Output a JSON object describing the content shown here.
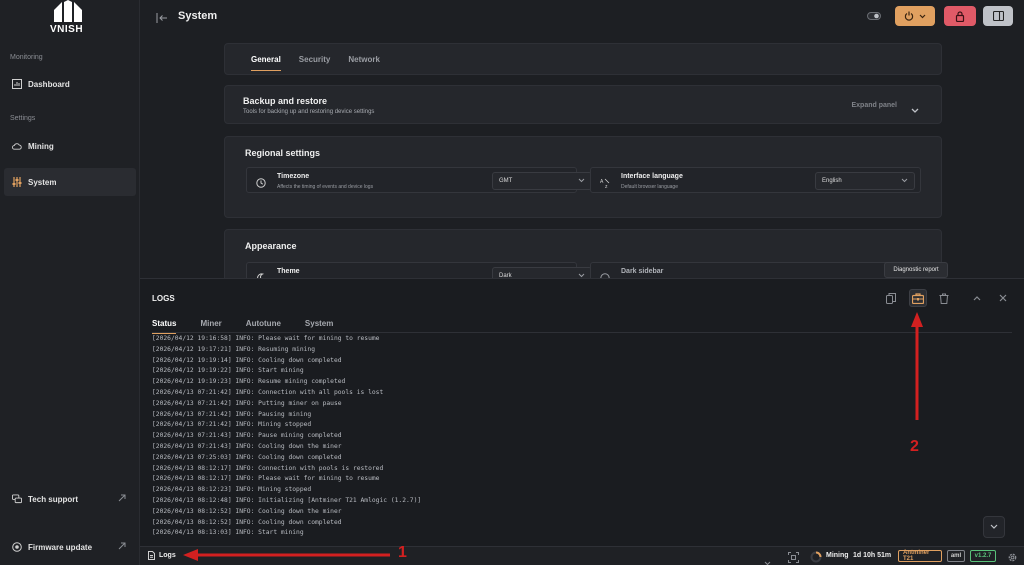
{
  "brand": {
    "name": "VNISH"
  },
  "sidebar": {
    "sections": [
      {
        "label": "Monitoring"
      },
      {
        "label": "Settings"
      }
    ],
    "items": [
      {
        "label": "Dashboard",
        "icon": "dashboard-icon"
      },
      {
        "label": "Mining",
        "icon": "cloud-icon"
      },
      {
        "label": "System",
        "icon": "sliders-icon"
      },
      {
        "label": "Tech support",
        "icon": "support-icon"
      },
      {
        "label": "Firmware update",
        "icon": "update-icon"
      }
    ]
  },
  "header": {
    "title": "System"
  },
  "system": {
    "tabs": [
      "General",
      "Security",
      "Network"
    ],
    "backup": {
      "title": "Backup and restore",
      "subtitle": "Tools for backing up and restoring device settings",
      "expand_label": "Expand panel"
    },
    "regional": {
      "title": "Regional settings",
      "timezone": {
        "title": "Timezone",
        "subtitle": "Affects the timing of events and device logs",
        "value": "GMT"
      },
      "language": {
        "title": "Interface language",
        "subtitle": "Default browser language",
        "value": "English"
      }
    },
    "appearance": {
      "title": "Appearance",
      "theme": {
        "title": "Theme",
        "value": "Dark"
      },
      "dark_sidebar": {
        "title": "Dark sidebar"
      }
    }
  },
  "logs": {
    "title": "LOGS",
    "tabs": [
      "Status",
      "Miner",
      "Autotune",
      "System"
    ],
    "tooltip": "Diagnostic report",
    "lines": [
      "[2026/04/12 19:16:58] INFO: Please wait for mining to resume",
      "[2026/04/12 19:17:21] INFO: Resuming mining",
      "[2026/04/12 19:19:14] INFO: Cooling down completed",
      "[2026/04/12 19:19:22] INFO: Start mining",
      "[2026/04/12 19:19:23] INFO: Resume mining completed",
      "[2026/04/13 07:21:42] INFO: Connection with all pools is lost",
      "[2026/04/13 07:21:42] INFO: Putting miner on pause",
      "[2026/04/13 07:21:42] INFO: Pausing mining",
      "[2026/04/13 07:21:42] INFO: Mining stopped",
      "[2026/04/13 07:21:43] INFO: Pause mining completed",
      "[2026/04/13 07:21:43] INFO: Cooling down the miner",
      "[2026/04/13 07:25:03] INFO: Cooling down completed",
      "[2026/04/13 08:12:17] INFO: Connection with pools is restored",
      "[2026/04/13 08:12:17] INFO: Please wait for mining to resume",
      "[2026/04/13 08:12:23] INFO: Mining stopped",
      "[2026/04/13 08:12:48] INFO: Initializing [Antminer T21 Amlogic (1.2.7)]",
      "[2026/04/13 08:12:52] INFO: Cooling down the miner",
      "[2026/04/13 08:12:52] INFO: Cooling down completed",
      "[2026/04/13 08:13:03] INFO: Start mining"
    ]
  },
  "statusbar": {
    "logs_label": "Logs",
    "mining_label": "Mining",
    "uptime": "1d 10h 51m",
    "model": "Antminer T21",
    "platform": "aml",
    "version": "v1.2.7"
  },
  "annotations": {
    "one": "1",
    "two": "2"
  },
  "colors": {
    "accent_orange": "#e0a060",
    "lock_red": "#e05a67",
    "annotation_red": "#d32020",
    "version_green": "#59c27a"
  }
}
